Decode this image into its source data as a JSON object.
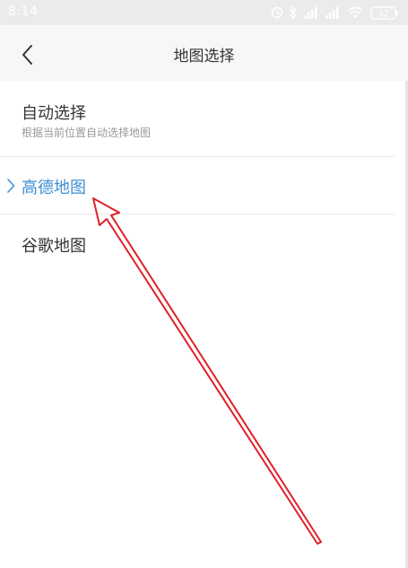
{
  "status_bar": {
    "time": "8:14",
    "battery": "32"
  },
  "header": {
    "title": "地图选择"
  },
  "options": [
    {
      "title": "自动选择",
      "subtitle": "根据当前位置自动选择地图"
    },
    {
      "title": "高德地图"
    },
    {
      "title": "谷歌地图"
    }
  ],
  "colors": {
    "accent": "#3f8fd2",
    "annotation": "#e0202a"
  }
}
